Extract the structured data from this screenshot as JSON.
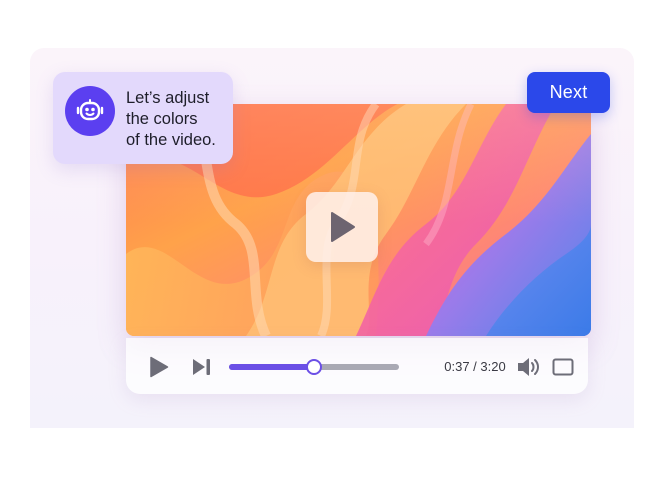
{
  "assistant": {
    "avatar_icon": "robot-face-icon",
    "message_lines": [
      "Let’s adjust",
      "the colors",
      "of the video."
    ]
  },
  "toolbar": {
    "next_label": "Next"
  },
  "player": {
    "center_play_icon": "play-icon",
    "controls": {
      "play_icon": "play-icon",
      "skip_icon": "skip-next-icon",
      "volume_icon": "volume-icon",
      "fullscreen_icon": "fullscreen-icon"
    },
    "current_time": "0:37",
    "duration": "3:20",
    "time_display": "0:37 / 3:20",
    "progress_fraction": 0.5
  },
  "colors": {
    "accent": "#6b4fe6",
    "primary_button": "#2b48ea",
    "assistant_card": "#e3d9fc",
    "avatar": "#5b3ff0"
  }
}
